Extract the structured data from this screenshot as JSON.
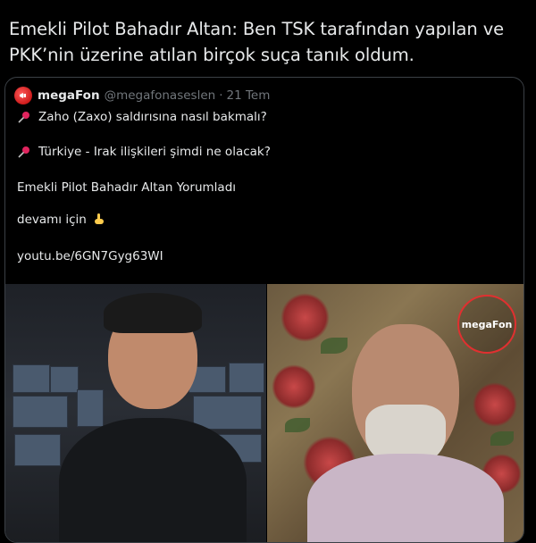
{
  "tweet": {
    "text": "Emekli Pilot Bahadır Altan: Ben TSK tarafından yapılan ve\nPKK’nin üzerine atılan birçok suça tanık oldum."
  },
  "quoted": {
    "name": "megaFon",
    "handle": "@megafonaseslen",
    "separator": "·",
    "date": "21 Tem",
    "lines": [
      {
        "icon": "pushpin-icon",
        "text": "Zaho (Zaxo)  saldırısına nasıl bakmalı?"
      },
      {
        "icon": "pushpin-icon",
        "text": "Türkiye - Irak ilişkileri şimdi ne olacak?"
      },
      {
        "icon": "",
        "text": "Emekli Pilot Bahadır Altan Yorumladı"
      },
      {
        "icon": "pointing-down-icon",
        "text": "devamı için"
      },
      {
        "icon": "",
        "text": "youtu.be/6GN7Gyg63WI"
      }
    ],
    "media": {
      "logo_text": "megaFon"
    }
  },
  "colors": {
    "background": "#000000",
    "text": "#e7e9ea",
    "muted": "#71767b",
    "border": "#3b4046",
    "brand_red": "#e03030"
  }
}
